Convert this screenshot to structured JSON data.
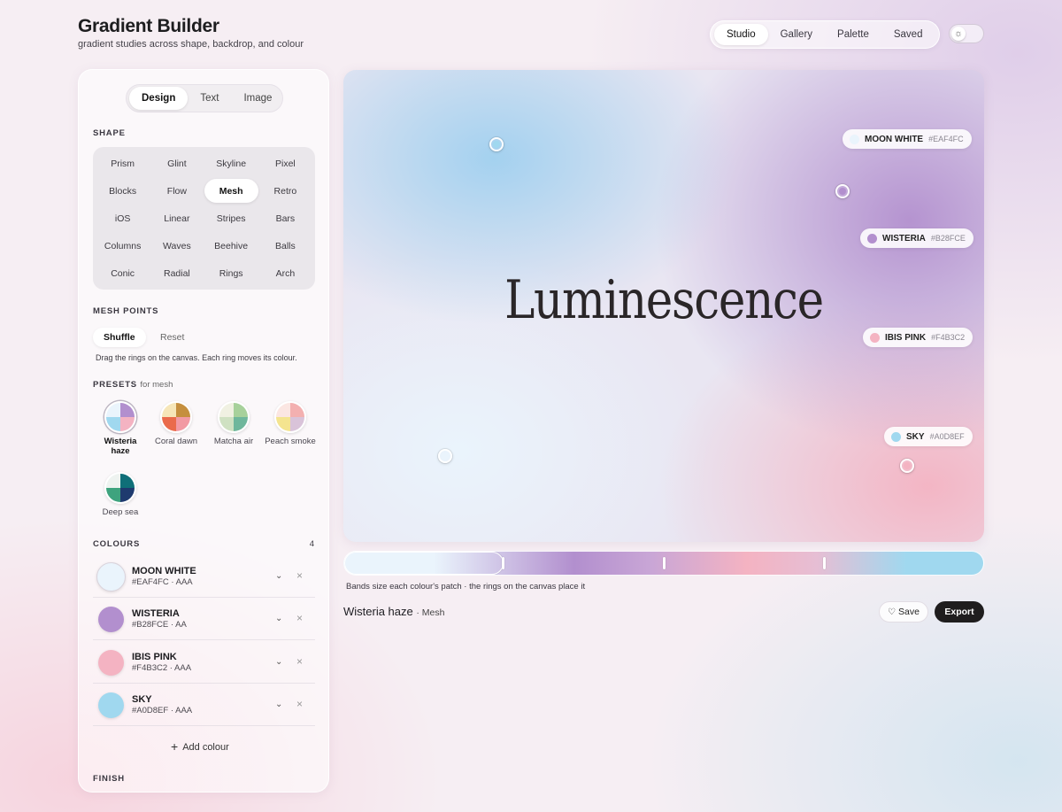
{
  "header": {
    "title": "Gradient Builder",
    "subtitle": "gradient studies across shape, backdrop, and colour"
  },
  "topnav": {
    "tabs": [
      "Studio",
      "Gallery",
      "Palette",
      "Saved"
    ],
    "active": "Studio"
  },
  "theme_toggle": {
    "icon": "sun-icon",
    "knob_symbol": "☼"
  },
  "sidebar": {
    "tabs": [
      "Design",
      "Text",
      "Image"
    ],
    "active_tab": "Design",
    "shape": {
      "label": "SHAPE",
      "items": [
        "Prism",
        "Glint",
        "Skyline",
        "Pixel",
        "Blocks",
        "Flow",
        "Mesh",
        "Retro",
        "iOS",
        "Linear",
        "Stripes",
        "Bars",
        "Columns",
        "Waves",
        "Beehive",
        "Balls",
        "Conic",
        "Radial",
        "Rings",
        "Arch"
      ],
      "active": "Mesh"
    },
    "mesh_points": {
      "label": "MESH POINTS",
      "shuffle": "Shuffle",
      "reset": "Reset",
      "help": "Drag the rings on the canvas. Each ring moves its colour."
    },
    "presets": {
      "label": "PRESETS",
      "sublabel": "for mesh",
      "items": [
        {
          "name": "Wisteria haze",
          "colors": [
            "#eaf4fc",
            "#b28fce",
            "#a0d8ef",
            "#f4b3c2"
          ],
          "active": true
        },
        {
          "name": "Coral dawn",
          "colors": [
            "#f6e6b8",
            "#c58f3e",
            "#ea6b4b",
            "#f29aa3"
          ],
          "active": false
        },
        {
          "name": "Matcha air",
          "colors": [
            "#f0f1e2",
            "#a7d19b",
            "#cfe1c2",
            "#6fb79c"
          ],
          "active": false
        },
        {
          "name": "Peach smoke",
          "colors": [
            "#fbe6e2",
            "#f3b0b0",
            "#f4e48f",
            "#d9c3d9"
          ],
          "active": false
        },
        {
          "name": "Deep sea",
          "colors": [
            "#eef3f0",
            "#0f6f78",
            "#3ea37e",
            "#1e3a6e"
          ],
          "active": false
        }
      ]
    },
    "colours": {
      "label": "COLOURS",
      "count": "4",
      "items": [
        {
          "name": "MOON WHITE",
          "meta": "#EAF4FC · AAA",
          "hex": "#EAF4FC"
        },
        {
          "name": "WISTERIA",
          "meta": "#B28FCE · AA",
          "hex": "#B28FCE"
        },
        {
          "name": "IBIS PINK",
          "meta": "#F4B3C2 · AAA",
          "hex": "#F4B3C2"
        },
        {
          "name": "SKY",
          "meta": "#A0D8EF · AAA",
          "hex": "#A0D8EF"
        }
      ],
      "add_label": "Add colour"
    },
    "finish": {
      "label": "FINISH"
    }
  },
  "canvas": {
    "hero_text": "Luminescence",
    "chips": [
      {
        "name": "MOON WHITE",
        "hex": "#EAF4FC"
      },
      {
        "name": "WISTERIA",
        "hex": "#B28FCE"
      },
      {
        "name": "IBIS PINK",
        "hex": "#F4B3C2"
      },
      {
        "name": "SKY",
        "hex": "#A0D8EF"
      }
    ]
  },
  "bands": {
    "help": "Bands size each colour's patch · the rings on the canvas place it"
  },
  "footer": {
    "current_name": "Wisteria haze",
    "current_kind": "· Mesh",
    "save_label": "Save",
    "export_label": "Export"
  }
}
